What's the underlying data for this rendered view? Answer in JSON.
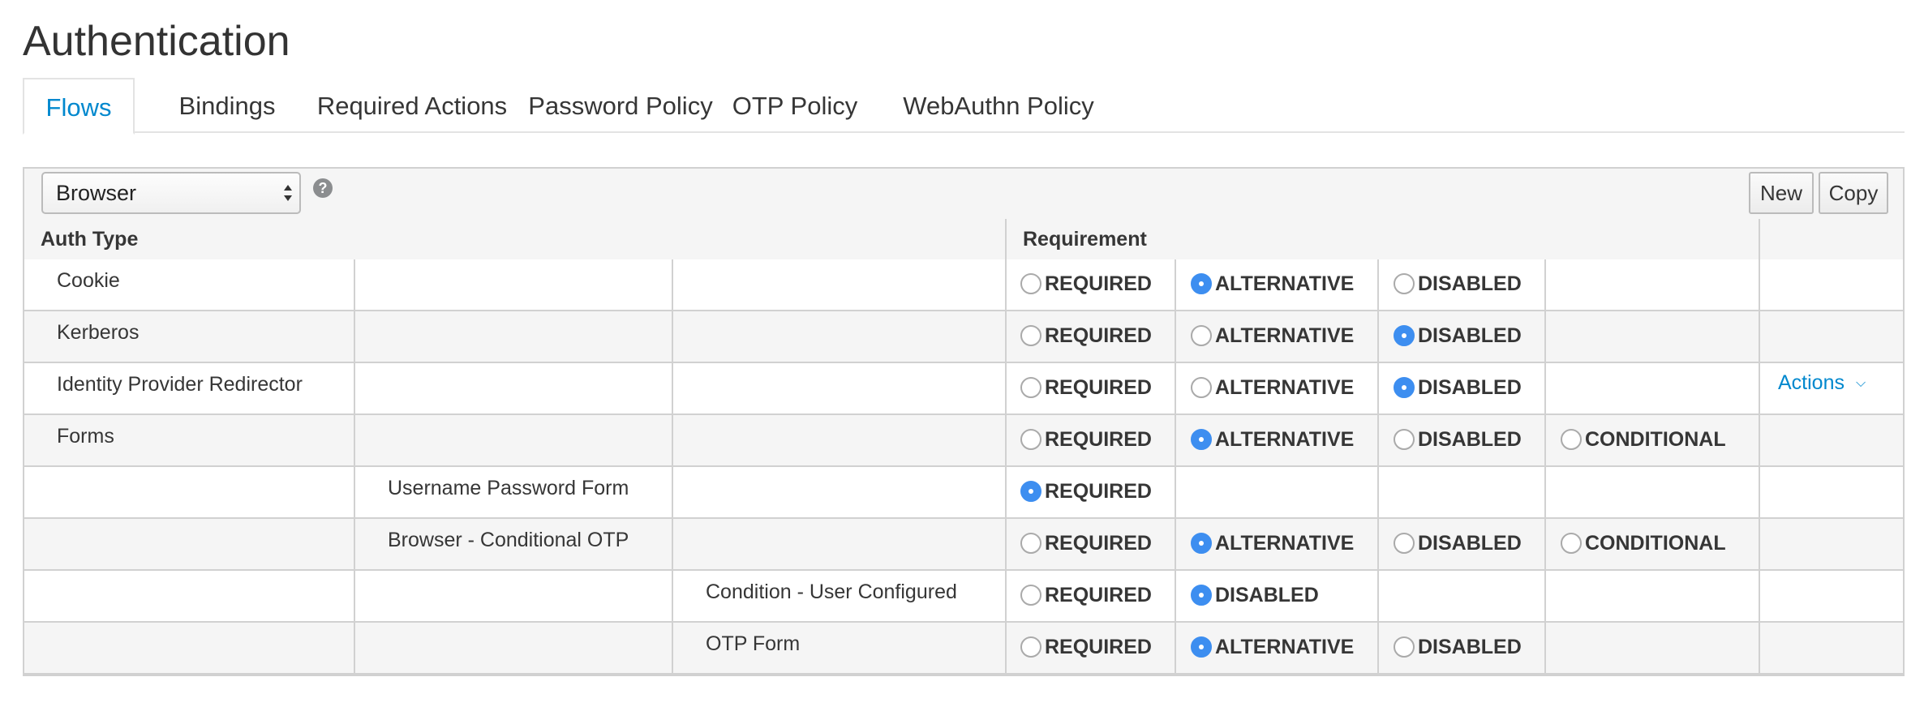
{
  "page": {
    "title": "Authentication"
  },
  "tabs": [
    {
      "label": "Flows",
      "active": true
    },
    {
      "label": "Bindings",
      "active": false
    },
    {
      "label": "Required Actions",
      "active": false
    },
    {
      "label": "Password Policy",
      "active": false
    },
    {
      "label": "OTP Policy",
      "active": false
    },
    {
      "label": "WebAuthn Policy",
      "active": false
    }
  ],
  "toolbar": {
    "flow_select_value": "Browser",
    "help_icon": "question-circle-icon",
    "new_label": "New",
    "copy_label": "Copy"
  },
  "table": {
    "headers": {
      "auth_type": "Auth Type",
      "requirement": "Requirement"
    },
    "rows": [
      {
        "name": "Cookie",
        "level": 0,
        "options": [
          "REQUIRED",
          "ALTERNATIVE",
          "DISABLED"
        ],
        "selected": "ALTERNATIVE"
      },
      {
        "name": "Kerberos",
        "level": 0,
        "options": [
          "REQUIRED",
          "ALTERNATIVE",
          "DISABLED"
        ],
        "selected": "DISABLED"
      },
      {
        "name": "Identity Provider Redirector",
        "level": 0,
        "options": [
          "REQUIRED",
          "ALTERNATIVE",
          "DISABLED"
        ],
        "selected": "DISABLED",
        "actions": "Actions"
      },
      {
        "name": "Forms",
        "level": 0,
        "options": [
          "REQUIRED",
          "ALTERNATIVE",
          "DISABLED",
          "CONDITIONAL"
        ],
        "selected": "ALTERNATIVE"
      },
      {
        "name": "Username Password Form",
        "level": 1,
        "options": [
          "REQUIRED"
        ],
        "selected": "REQUIRED"
      },
      {
        "name": "Browser - Conditional OTP",
        "level": 1,
        "options": [
          "REQUIRED",
          "ALTERNATIVE",
          "DISABLED",
          "CONDITIONAL"
        ],
        "selected": "ALTERNATIVE"
      },
      {
        "name": "Condition - User Configured",
        "level": 2,
        "options": [
          "REQUIRED",
          "DISABLED"
        ],
        "selected": "DISABLED"
      },
      {
        "name": "OTP Form",
        "level": 2,
        "options": [
          "REQUIRED",
          "ALTERNATIVE",
          "DISABLED"
        ],
        "selected": "ALTERNATIVE"
      }
    ]
  },
  "colors": {
    "accent": "#0088ce",
    "radio_selected": "#3d8ef0",
    "row_alt": "#f5f5f5",
    "border": "#d1d1d1"
  }
}
